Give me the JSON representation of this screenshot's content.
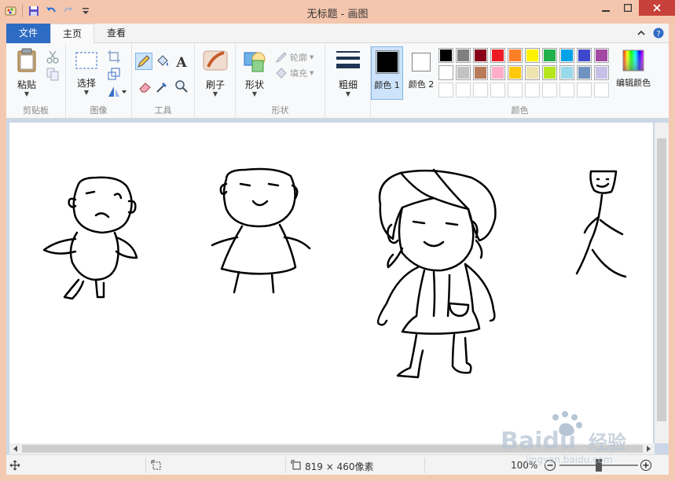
{
  "window": {
    "title": "无标题 - 画图",
    "titlebar_color": "#f4c6ad",
    "close_color": "#c7403a"
  },
  "tabs": {
    "file": "文件",
    "home": "主页",
    "view": "查看"
  },
  "ribbon": {
    "clipboard": {
      "paste": "粘贴",
      "group": "剪贴板"
    },
    "image": {
      "select": "选择",
      "group": "图像"
    },
    "tools": {
      "group": "工具",
      "text_glyph": "A"
    },
    "brushes": {
      "label": "刷子"
    },
    "shapes": {
      "shapes": "形状",
      "outline": "轮廓",
      "fill": "填充",
      "group": "形状"
    },
    "size": {
      "label": "粗细"
    },
    "colors": {
      "color1": "颜色 1",
      "color2": "颜色 2",
      "edit": "编辑颜色",
      "group": "颜色",
      "row1": [
        "#000000",
        "#7f7f7f",
        "#880015",
        "#ed1c24",
        "#ff7f27",
        "#fff200",
        "#22b14c",
        "#00a2e8",
        "#3f48cc",
        "#a349a4"
      ],
      "row2": [
        "#ffffff",
        "#c3c3c3",
        "#b97a57",
        "#ffaec9",
        "#ffc90e",
        "#efe4b0",
        "#b5e61d",
        "#99d9ea",
        "#7092be",
        "#c8bfe7"
      ],
      "color1_value": "#000000",
      "color2_value": "#ffffff"
    }
  },
  "status": {
    "dimensions": "819 × 460像素",
    "zoom": "100%"
  },
  "watermark": {
    "brand": "Baidu",
    "cn": "经验",
    "url": "jingyan.baidu.com"
  }
}
